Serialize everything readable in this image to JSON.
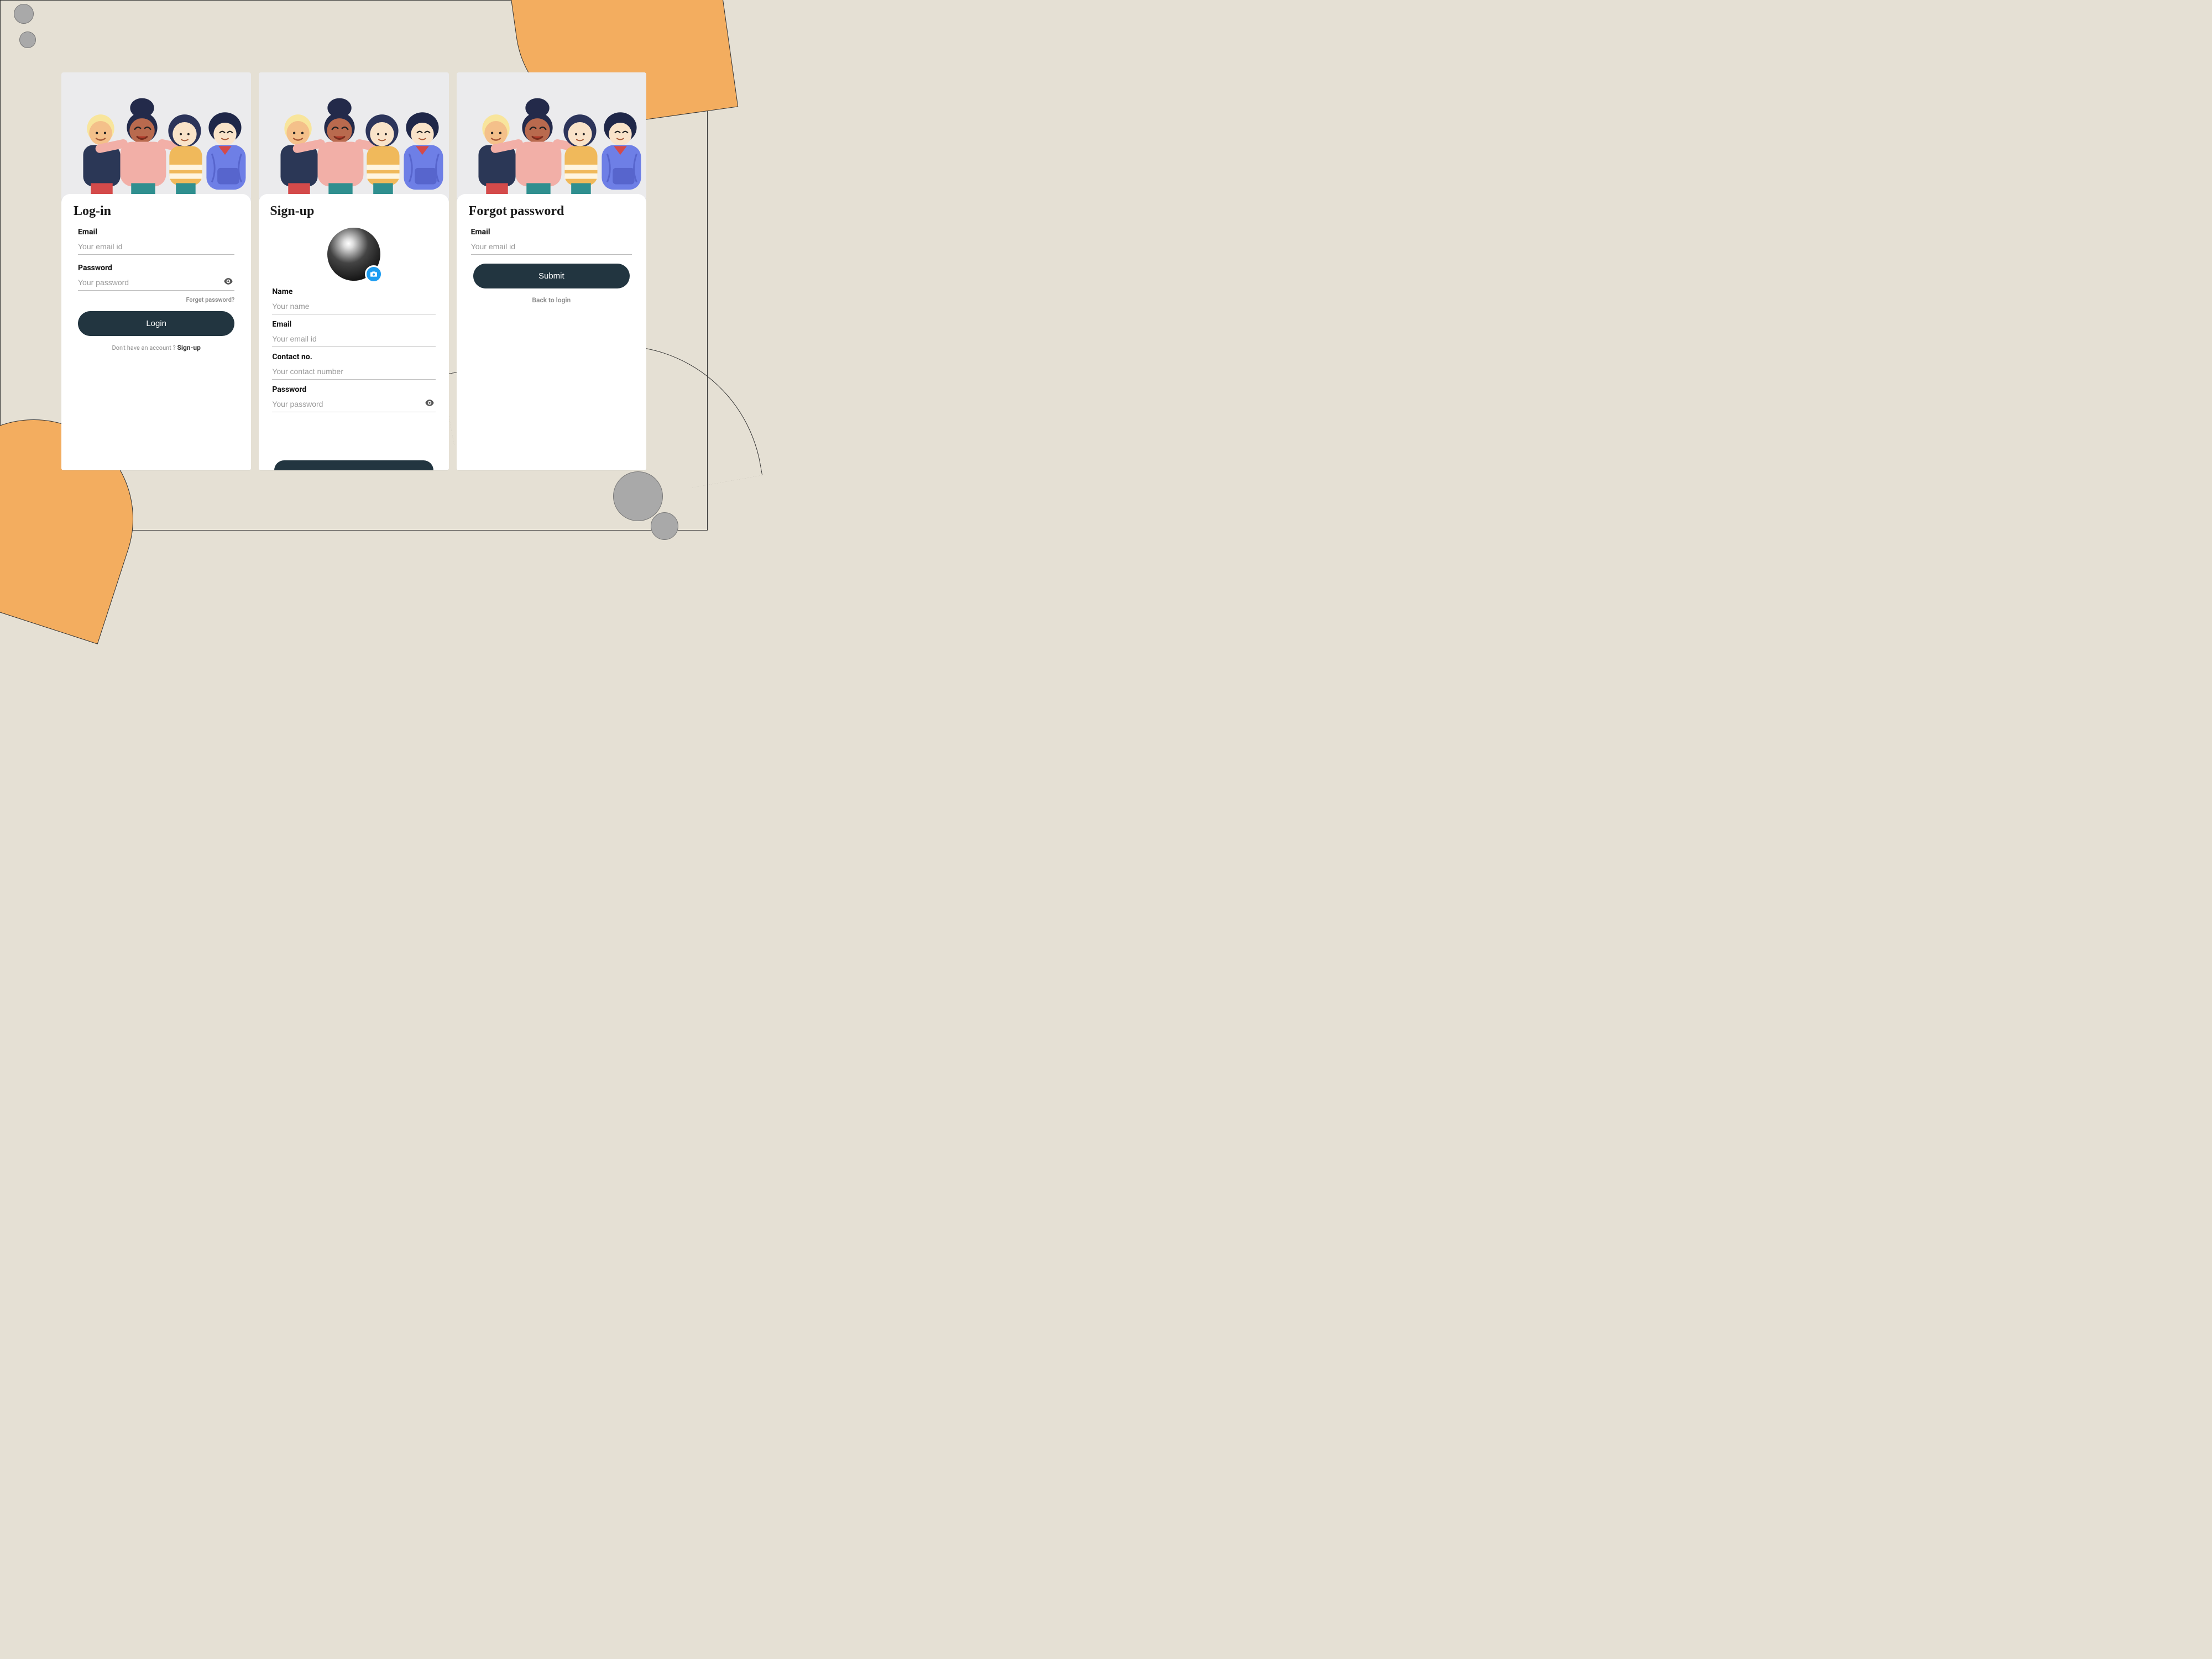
{
  "login": {
    "title": "Log-in",
    "email": {
      "label": "Email",
      "placeholder": "Your email id"
    },
    "password": {
      "label": "Password",
      "placeholder": "Your password"
    },
    "forgot_link": "Forget password?",
    "button_label": "Login",
    "footer_prompt": "Don't have an account ? ",
    "footer_action": "Sign-up"
  },
  "signup": {
    "title": "Sign-up",
    "name": {
      "label": "Name",
      "placeholder": "Your name"
    },
    "email": {
      "label": "Email",
      "placeholder": "Your email id"
    },
    "contact": {
      "label": "Contact no.",
      "placeholder": "Your contact number"
    },
    "password": {
      "label": "Password",
      "placeholder": "Your password"
    }
  },
  "forgot": {
    "title": "Forgot password",
    "email": {
      "label": "Email",
      "placeholder": "Your email id"
    },
    "button_label": "Submit",
    "back_link": "Back to login"
  },
  "colors": {
    "accent_button": "#223540",
    "camera_button": "#1e9df1",
    "background": "#e5e0d4",
    "blob": "#f3ad5f"
  },
  "icons": {
    "eye": "eye-icon",
    "camera": "camera-icon"
  }
}
